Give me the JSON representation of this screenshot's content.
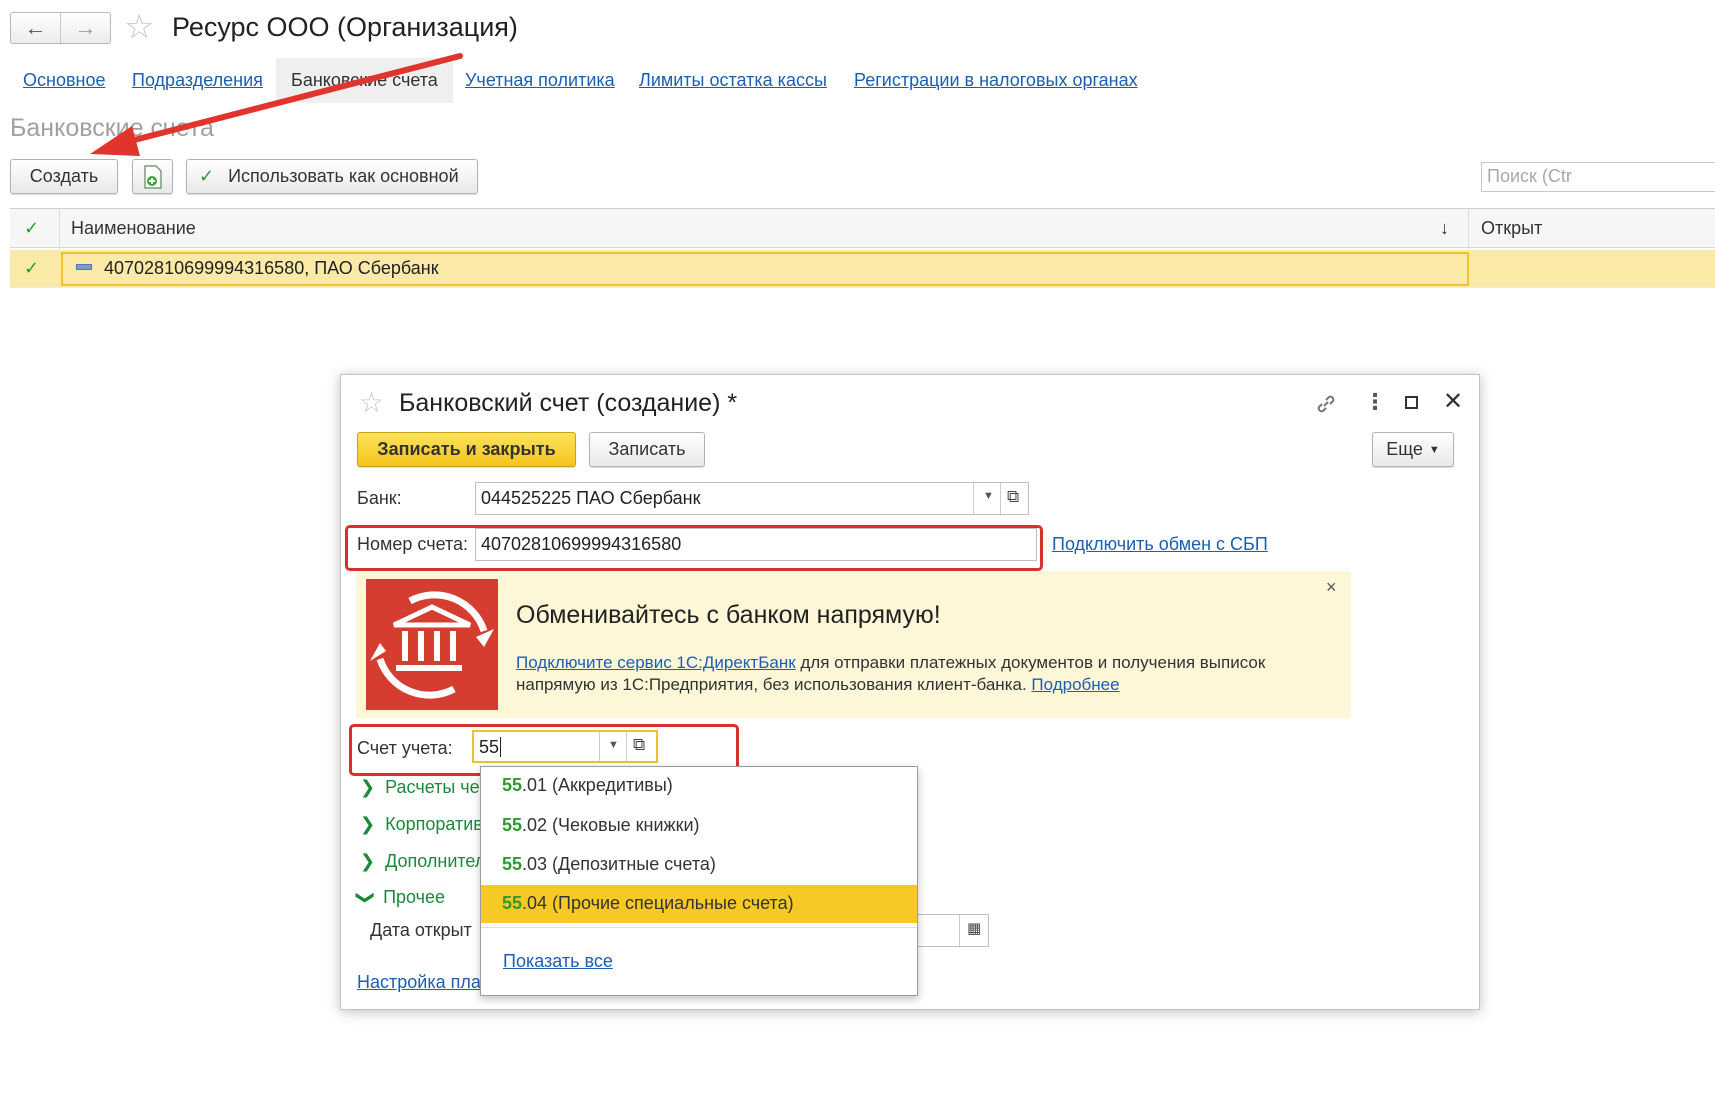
{
  "header": {
    "back_label": "←",
    "forward_label": "→",
    "title": "Ресурс ООО (Организация)"
  },
  "tabs": [
    {
      "label": "Основное"
    },
    {
      "label": "Подразделения"
    },
    {
      "label": "Банковские счета"
    },
    {
      "label": "Учетная политика"
    },
    {
      "label": "Лимиты остатка кассы"
    },
    {
      "label": "Регистрации в налоговых органах"
    }
  ],
  "section_title": "Банковские счета",
  "toolbar": {
    "create_label": "Создать",
    "use_main_label": "Использовать как основной",
    "search_placeholder": "Поиск (Ctr"
  },
  "list": {
    "columns": [
      "Наименование",
      "Открыт"
    ],
    "sort_indicator": "↓",
    "rows": [
      {
        "name": "40702810699994316580, ПАО Сбербанк"
      }
    ]
  },
  "dialog": {
    "title": "Банковский счет (создание) *",
    "save_close_label": "Записать и закрыть",
    "save_label": "Записать",
    "more_label": "Еще",
    "bank_label": "Банк:",
    "bank_value": "044525225 ПАО Сбербанк",
    "account_number_label": "Номер счета:",
    "account_number_value": "40702810699994316580",
    "sbp_link": "Подключить обмен с СБП",
    "banner": {
      "heading": "Обменивайтесь с банком напрямую!",
      "link1": "Подключите сервис 1С:ДиректБанк",
      "text1": " для отправки платежных документов и получения выписок",
      "text2": "напрямую из 1С:Предприятия, без использования клиент-банка. ",
      "link2": "Подробнее",
      "close": "×"
    },
    "accounting_label": "Счет учета:",
    "accounting_value": "55",
    "groups": [
      {
        "label": "Расчеты че"
      },
      {
        "label": "Корпоратив"
      },
      {
        "label": "Дополнител"
      },
      {
        "label": "Прочее"
      }
    ],
    "open_date_label": "Дата открыт",
    "settings_link": "Настройка пла"
  },
  "dropdown": {
    "items": [
      {
        "code": "55",
        "rest": ".01 (Аккредитивы)"
      },
      {
        "code": "55",
        "rest": ".02 (Чековые книжки)"
      },
      {
        "code": "55",
        "rest": ".03 (Депозитные счета)"
      },
      {
        "code": "55",
        "rest": ".04 (Прочие специальные счета)"
      }
    ],
    "show_all": "Показать все"
  },
  "colors": {
    "accent_yellow": "#f7c924",
    "link_blue": "#1b5eb5",
    "green": "#2e9b2e",
    "red_highlight": "#d9302b",
    "banner_red": "#d43d2f"
  }
}
